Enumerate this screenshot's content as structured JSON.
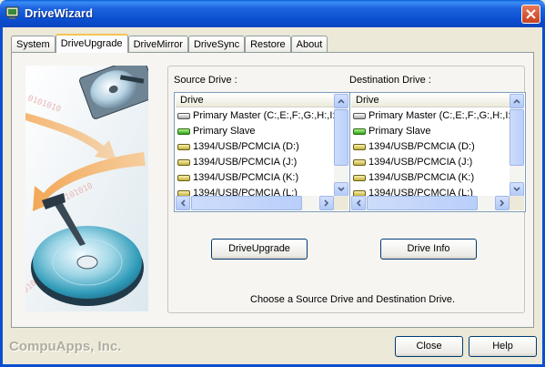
{
  "window": {
    "title": "DriveWizard"
  },
  "tabs": [
    {
      "label": "System",
      "active": false
    },
    {
      "label": "DriveUpgrade",
      "active": true
    },
    {
      "label": "DriveMirror",
      "active": false
    },
    {
      "label": "DriveSync",
      "active": false
    },
    {
      "label": "Restore",
      "active": false
    },
    {
      "label": "About",
      "active": false
    }
  ],
  "source": {
    "label": "Source Drive :",
    "column_header": "Drive",
    "items": [
      {
        "label": "Primary Master (C:,E:,F:,G:,H:,I:",
        "icon": "grey-drive-icon"
      },
      {
        "label": "Primary Slave",
        "icon": "green-drive-icon"
      },
      {
        "label": "1394/USB/PCMCIA (D:)",
        "icon": "yellow-drive-icon"
      },
      {
        "label": "1394/USB/PCMCIA (J:)",
        "icon": "yellow-drive-icon"
      },
      {
        "label": "1394/USB/PCMCIA (K:)",
        "icon": "yellow-drive-icon"
      },
      {
        "label": "1394/USB/PCMCIA (L:)",
        "icon": "yellow-drive-icon"
      }
    ]
  },
  "destination": {
    "label": "Destination Drive :",
    "column_header": "Drive",
    "items": [
      {
        "label": "Primary Master (C:,E:,F:,G:,H:,I:",
        "icon": "grey-drive-icon"
      },
      {
        "label": "Primary Slave",
        "icon": "green-drive-icon"
      },
      {
        "label": "1394/USB/PCMCIA (D:)",
        "icon": "yellow-drive-icon"
      },
      {
        "label": "1394/USB/PCMCIA (J:)",
        "icon": "yellow-drive-icon"
      },
      {
        "label": "1394/USB/PCMCIA (K:)",
        "icon": "yellow-drive-icon"
      },
      {
        "label": "1394/USB/PCMCIA (L:)",
        "icon": "yellow-drive-icon"
      }
    ]
  },
  "buttons": {
    "upgrade": "DriveUpgrade",
    "drive_info": "Drive Info",
    "close": "Close",
    "help": "Help"
  },
  "status_text": "Choose a Source Drive and Destination Drive.",
  "footer": {
    "company": "CompuApps, Inc."
  },
  "colors": {
    "title_bar": "#0a4fd0",
    "close_button": "#c4401f",
    "tab_highlight": "#f5c355"
  }
}
